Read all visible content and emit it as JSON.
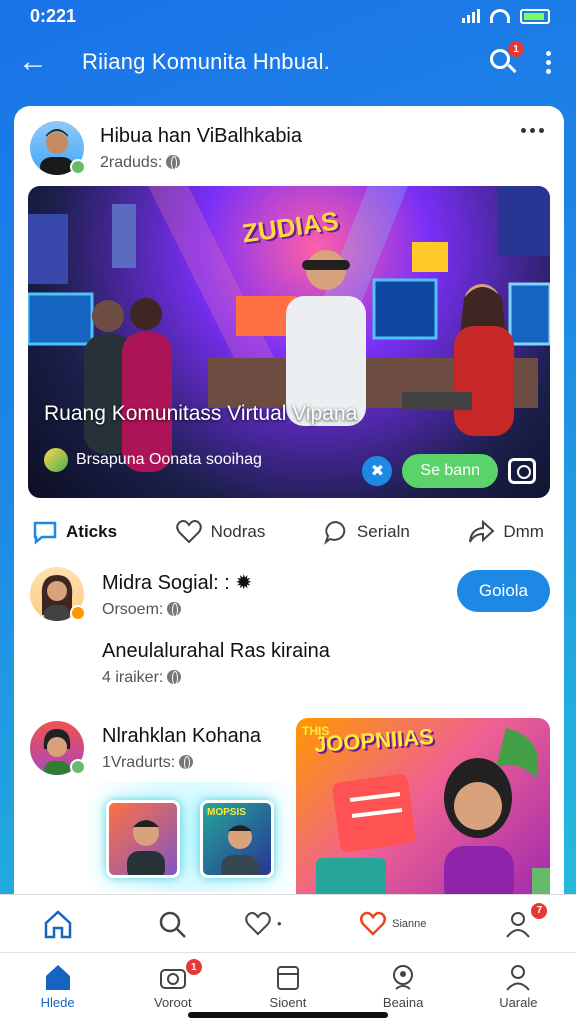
{
  "status_bar": {
    "time": "0:221"
  },
  "app_bar": {
    "title": "Riiang Komunita Hnbual.",
    "search_badge": "1"
  },
  "post": {
    "author": "Hibua han ViBalhkabia",
    "meta": "2raduds:",
    "image_caption": "Ruang Komunitass Virtual Vipana",
    "image_sub": "Brsapuna Oonata sooihag",
    "image_button": "Se bann",
    "image_sign_text": "ZUDIAS"
  },
  "actions": [
    {
      "label": "Aticks",
      "icon": "chat-bubble-icon"
    },
    {
      "label": "Nodras",
      "icon": "heart-icon"
    },
    {
      "label": "Serialn",
      "icon": "comment-icon"
    },
    {
      "label": "Dmm",
      "icon": "share-icon"
    }
  ],
  "suggestion1": {
    "name": "Midra Sogial: :",
    "meta": "Orsoem:",
    "follow_label": "Goiola"
  },
  "text_row": {
    "title": "Aneulalurahal Ras kiraina",
    "meta": "4 iraiker:"
  },
  "suggestion2": {
    "name": "Nlrahklan Kohana",
    "meta": "1Vradurts:"
  },
  "promo": {
    "title": "JOOPNIIAS",
    "corner": "THIS"
  },
  "thumb_sign": "MOPSIS",
  "bar1_items": [
    {
      "icon": "home-outline-icon",
      "label": ""
    },
    {
      "icon": "search-icon",
      "label": ""
    },
    {
      "icon": "heart-outline-icon",
      "label": "•"
    },
    {
      "icon": "heart-red-icon",
      "label": "Sianne"
    },
    {
      "icon": "profile-icon",
      "label": "",
      "badge": "7"
    }
  ],
  "bottom_nav": [
    {
      "label": "Hlede",
      "icon": "home-filled-icon"
    },
    {
      "label": "Voroot",
      "icon": "camera-icon",
      "badge": "1"
    },
    {
      "label": "Sioent",
      "icon": "calendar-icon"
    },
    {
      "label": "Beaina",
      "icon": "globe-person-icon"
    },
    {
      "label": "Uarale",
      "icon": "user-icon"
    }
  ],
  "colors": {
    "accent": "#1e88e5",
    "green": "#5bd36b",
    "badge": "#e53935"
  }
}
